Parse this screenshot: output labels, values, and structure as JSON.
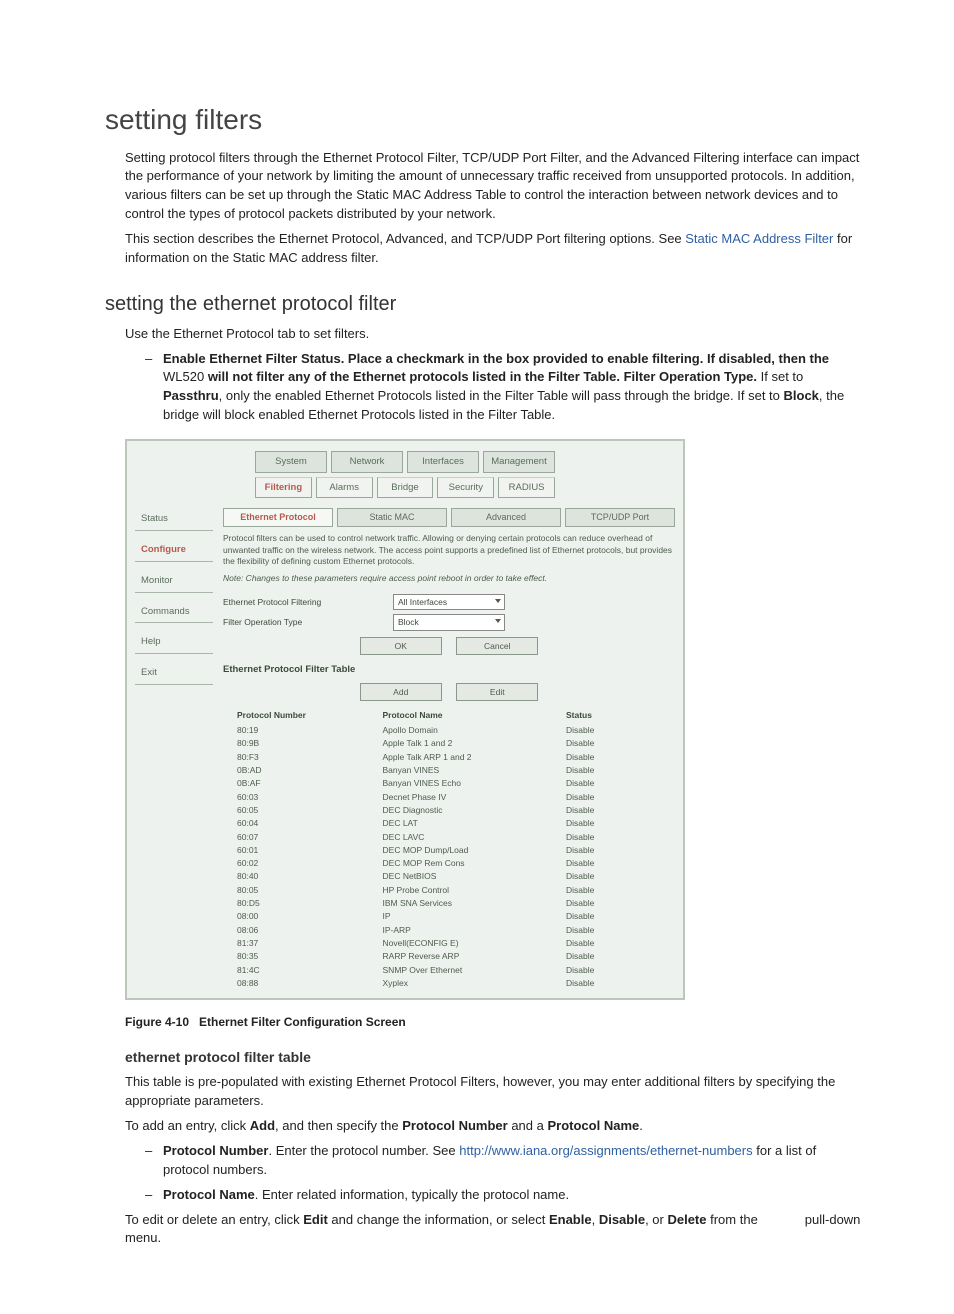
{
  "h1": "setting filters",
  "intro_p1": "Setting protocol filters through the Ethernet Protocol Filter, TCP/UDP Port Filter, and the Advanced Filtering interface can impact the performance of your network by limiting the amount of unnecessary traffic received from unsupported protocols. In addition, various filters can be set up through the Static MAC Address Table to control the interaction between network devices and to control the types of protocol packets distributed by your network.",
  "intro_p2_a": "This section describes the Ethernet Protocol, Advanced, and TCP/UDP Port filtering options. See ",
  "intro_p2_link": "Static MAC Address Filter",
  "intro_p2_b": " for information on the Static MAC address filter.",
  "h2_1": "setting the ethernet protocol filter",
  "use_tab": "Use the Ethernet Protocol tab to set filters.",
  "bold_a": "Enable Ethernet Filter Status. Place a checkmark in the box provided to enable filtering. If disabled, then the ",
  "wl520": "WL520",
  "bold_b": " will not filter any of the Ethernet protocols listed in the Filter Table. Filter Operation Type.",
  "after_operation_a": " If set to ",
  "passthru": "Passthru",
  "after_passthru": ", only the enabled Ethernet Protocols listed in the Filter Table will pass through the bridge. If set to ",
  "block": "Block",
  "after_block": ", the bridge will block enabled Ethernet Protocols listed in the Filter Table.",
  "figure_caption_bold": "Figure 4-10",
  "figure_caption_rest": "Ethernet Filter Configuration Screen",
  "h3_1": "ethernet protocol filter table",
  "table_p1": "This table is pre-populated with existing Ethernet Protocol Filters, however, you may enter additional filters by specifying the appropriate parameters.",
  "add_p_a": "To add an entry, click ",
  "add_lbl": "Add",
  "add_p_b": ", and then specify the ",
  "pnum_lbl": "Protocol Number",
  "add_p_c": " and a ",
  "pname_lbl": "Protocol Name",
  "dot": ".",
  "li_pnum_a": ". Enter the protocol number. See ",
  "li_pnum_link": "http://www.iana.org/assignments/ethernet-numbers",
  "li_pnum_b": " for a list of protocol numbers.",
  "li_pname": ". Enter related information, typically the protocol name.",
  "edit_p_a": "To edit or delete an entry, click ",
  "edit_lbl": "Edit",
  "edit_p_b": " and change the information, or select ",
  "enable_lbl": "Enable",
  "disable_lbl": "Disable",
  "delete_lbl": "Delete",
  "edit_p_c": " from the ",
  "edit_p_d": " pull-down menu.",
  "ui": {
    "top_tabs": [
      "System",
      "Network",
      "Interfaces",
      "Management"
    ],
    "second_tabs": [
      "Filtering",
      "Alarms",
      "Bridge",
      "Security",
      "RADIUS"
    ],
    "active_top_index": null,
    "active_second_index": 0,
    "sidebar": [
      "Status",
      "Configure",
      "Monitor",
      "Commands",
      "Help",
      "Exit"
    ],
    "sidebar_active": 1,
    "subtabs": [
      "Ethernet Protocol",
      "Static MAC",
      "Advanced",
      "TCP/UDP Port"
    ],
    "subtabs_active": 0,
    "desc": "Protocol filters can be used to control network traffic. Allowing or denying certain protocols can reduce overhead of unwanted traffic on the wireless network. The access point supports a predefined list of Ethernet protocols, but provides the flexibility of defining custom Ethernet protocols.",
    "note": "Note: Changes to these parameters require access point reboot in order to take effect.",
    "form": {
      "filtering_label": "Ethernet Protocol Filtering",
      "filtering_value": "All Interfaces",
      "operation_label": "Filter Operation Type",
      "operation_value": "Block"
    },
    "btn_ok": "OK",
    "btn_cancel": "Cancel",
    "table_title": "Ethernet Protocol Filter Table",
    "btn_add": "Add",
    "btn_edit": "Edit",
    "th_num": "Protocol Number",
    "th_name": "Protocol Name",
    "th_status": "Status",
    "protocol_rows": [
      {
        "num": "80:19",
        "name": "Apollo Domain",
        "status": "Disable"
      },
      {
        "num": "80:9B",
        "name": "Apple Talk 1 and 2",
        "status": "Disable"
      },
      {
        "num": "80:F3",
        "name": "Apple Talk ARP 1 and 2",
        "status": "Disable"
      },
      {
        "num": "0B:AD",
        "name": "Banyan VINES",
        "status": "Disable"
      },
      {
        "num": "0B:AF",
        "name": "Banyan VINES Echo",
        "status": "Disable"
      },
      {
        "num": "60:03",
        "name": "Decnet Phase IV",
        "status": "Disable"
      },
      {
        "num": "60:05",
        "name": "DEC Diagnostic",
        "status": "Disable"
      },
      {
        "num": "60:04",
        "name": "DEC LAT",
        "status": "Disable"
      },
      {
        "num": "60:07",
        "name": "DEC LAVC",
        "status": "Disable"
      },
      {
        "num": "60:01",
        "name": "DEC MOP Dump/Load",
        "status": "Disable"
      },
      {
        "num": "60:02",
        "name": "DEC MOP Rem Cons",
        "status": "Disable"
      },
      {
        "num": "80:40",
        "name": "DEC NetBIOS",
        "status": "Disable"
      },
      {
        "num": "80:05",
        "name": "HP Probe Control",
        "status": "Disable"
      },
      {
        "num": "80:D5",
        "name": "IBM SNA Services",
        "status": "Disable"
      },
      {
        "num": "08:00",
        "name": "IP",
        "status": "Disable"
      },
      {
        "num": "08:06",
        "name": "IP-ARP",
        "status": "Disable"
      },
      {
        "num": "81:37",
        "name": "Novell(ECONFIG E)",
        "status": "Disable"
      },
      {
        "num": "80:35",
        "name": "RARP Reverse ARP",
        "status": "Disable"
      },
      {
        "num": "81:4C",
        "name": "SNMP Over Ethernet",
        "status": "Disable"
      },
      {
        "num": "08:88",
        "name": "Xyplex",
        "status": "Disable"
      }
    ]
  }
}
